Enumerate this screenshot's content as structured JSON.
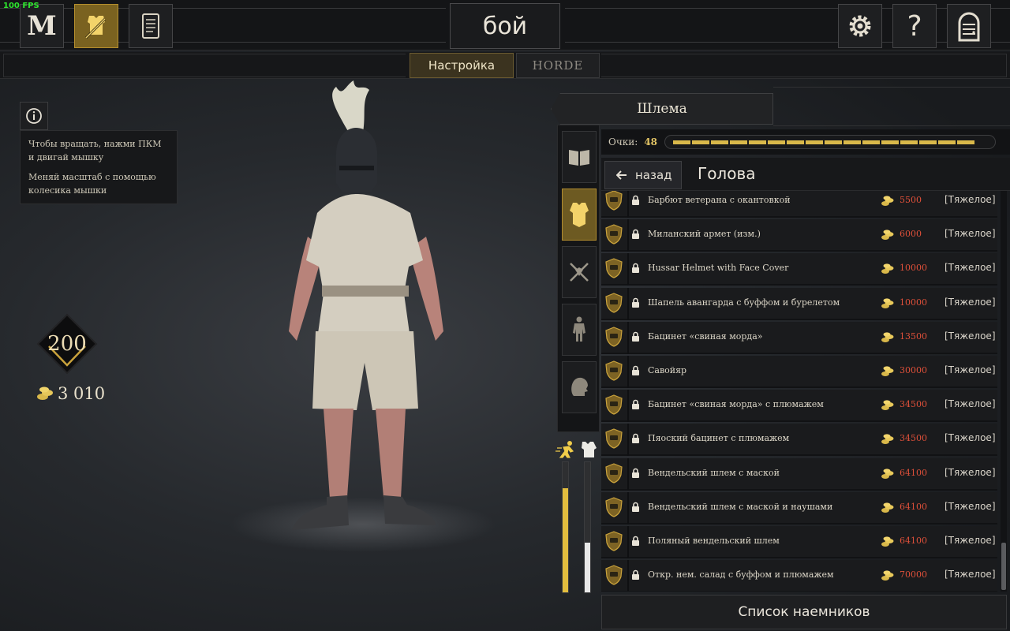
{
  "fps": "100 FPS",
  "top": {
    "mode_title": "бой",
    "logo_letter": "M"
  },
  "tabs": [
    {
      "label": "Настройка",
      "selected": true
    },
    {
      "label": "HORDE",
      "selected": false
    }
  ],
  "info": {
    "lines": [
      "Чтобы вращать, нажми ПКМ и двигай мышку",
      "Меняй масштаб с помощью колесика мышки"
    ]
  },
  "player": {
    "rank": "200",
    "gold": "3 010"
  },
  "panel": {
    "category_title": "Шлема",
    "points_label": "Очки:",
    "points_value": "48",
    "back_label": "назад",
    "section_title": "Голова"
  },
  "items": [
    {
      "name": "Барбют ветерана с окантовкой",
      "price": "5500",
      "tier": "[Тяжелое]"
    },
    {
      "name": "Миланский армет (изм.)",
      "price": "6000",
      "tier": "[Тяжелое]"
    },
    {
      "name": "Hussar Helmet with Face Cover",
      "price": "10000",
      "tier": "[Тяжелое]"
    },
    {
      "name": "Шапель авангарда с буффом и бурелетом",
      "price": "10000",
      "tier": "[Тяжелое]"
    },
    {
      "name": "Бацинет «свиная морда»",
      "price": "13500",
      "tier": "[Тяжелое]"
    },
    {
      "name": "Савойяр",
      "price": "30000",
      "tier": "[Тяжелое]"
    },
    {
      "name": "Бацинет «свиная морда» с плюмажем",
      "price": "34500",
      "tier": "[Тяжелое]"
    },
    {
      "name": "Пяоский бацинет с плюмажем",
      "price": "34500",
      "tier": "[Тяжелое]"
    },
    {
      "name": "Вендельский шлем с маской",
      "price": "64100",
      "tier": "[Тяжелое]"
    },
    {
      "name": "Вендельский шлем с маской и наушами",
      "price": "64100",
      "tier": "[Тяжелое]"
    },
    {
      "name": "Поляный вендельский шлем",
      "price": "64100",
      "tier": "[Тяжелое]"
    },
    {
      "name": "Откр. нем. салад с буффом и плюмажем",
      "price": "70000",
      "tier": "[Тяжелое]"
    }
  ],
  "stats": {
    "speed_fraction": 0.8,
    "armor_fraction": 0.38
  },
  "colors": {
    "gold": "#d9b84a",
    "price": "#e0503a",
    "active": "#6d5a22"
  },
  "footer": {
    "mercenaries_label": "Список наемников"
  }
}
